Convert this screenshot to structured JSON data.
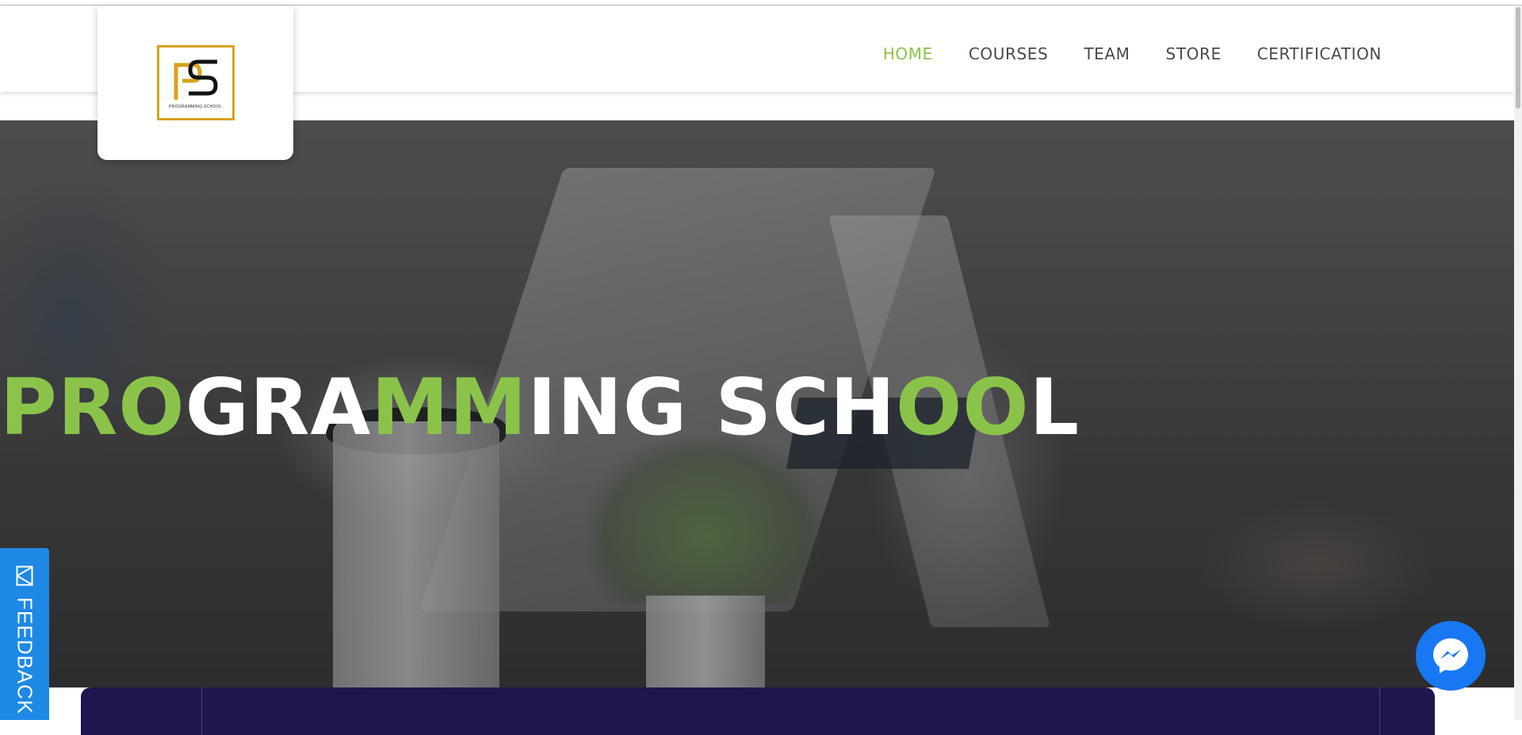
{
  "brand": {
    "logo_letters": "PS",
    "logo_caption": "PROGRAMMING SCHOOL",
    "accent_color": "#8bc34a",
    "logo_border_color": "#d8a21c"
  },
  "nav": {
    "items": [
      {
        "label": "HOME",
        "active": true
      },
      {
        "label": "COURSES",
        "active": false
      },
      {
        "label": "TEAM",
        "active": false
      },
      {
        "label": "STORE",
        "active": false
      },
      {
        "label": "CERTIFICATION",
        "active": false
      }
    ]
  },
  "hero": {
    "title_parts": [
      {
        "text": "PRO",
        "color": "green"
      },
      {
        "text": "GRA",
        "color": "white"
      },
      {
        "text": "MM",
        "color": "green"
      },
      {
        "text": "ING SCH",
        "color": "white"
      },
      {
        "text": "OO",
        "color": "green"
      },
      {
        "text": "L",
        "color": "white"
      }
    ]
  },
  "feedback": {
    "label": "FEEDBACK",
    "icon": "feedback-icon"
  },
  "messenger": {
    "icon": "messenger-icon",
    "color": "#1877f2"
  },
  "bottom_bar": {
    "color": "#20154f"
  }
}
